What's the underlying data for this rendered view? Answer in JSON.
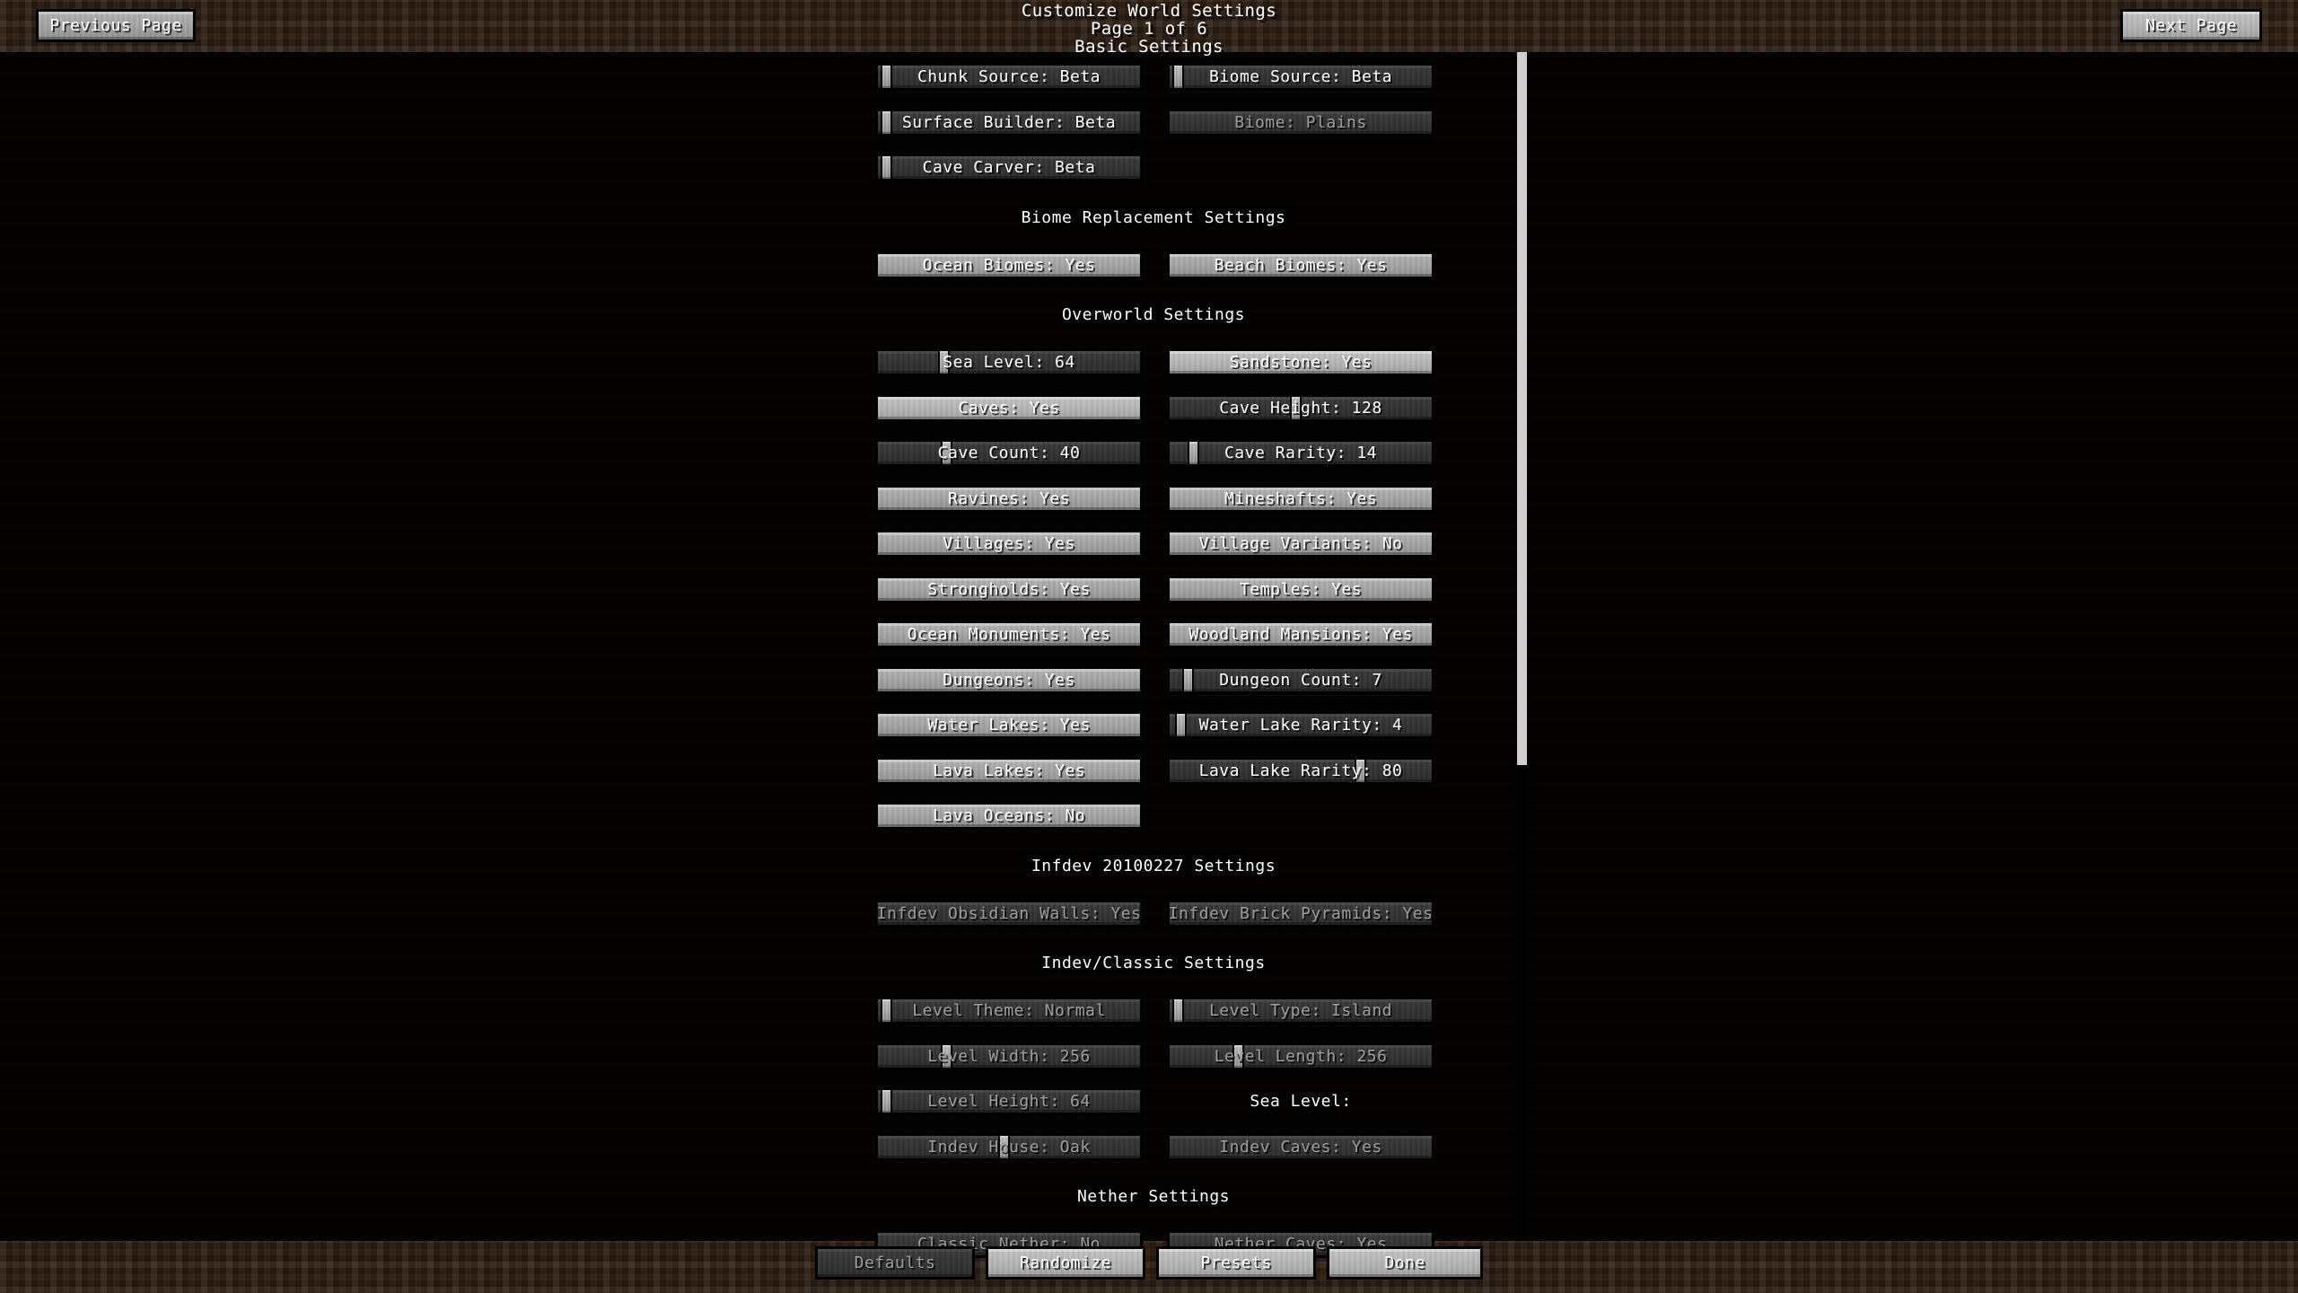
{
  "window": {
    "title": "Customize World Settings",
    "page_indicator": "Page 1 of 6",
    "subtitle": "Basic Settings"
  },
  "nav": {
    "previous_page": "Previous Page",
    "next_page": "Next Page"
  },
  "footer": {
    "defaults": "Defaults",
    "randomize": "Randomize",
    "presets": "Presets",
    "done": "Done"
  },
  "scrollbar": {
    "thumb_top_pct": 0,
    "thumb_height_pct": 60
  },
  "sections": [
    {
      "heading": "",
      "rows": [
        {
          "left": {
            "label": "Chunk Source: Beta",
            "state": "slider",
            "knob_pct": 1
          },
          "right": {
            "label": "Biome Source: Beta",
            "state": "slider",
            "knob_pct": 1
          }
        },
        {
          "left": {
            "label": "Surface Builder: Beta",
            "state": "slider",
            "knob_pct": 1
          },
          "right": {
            "label": "Biome: Plains",
            "state": "disabled"
          }
        },
        {
          "left": {
            "label": "Cave Carver: Beta",
            "state": "slider",
            "knob_pct": 1
          },
          "right": null
        }
      ]
    },
    {
      "heading": "Biome Replacement Settings",
      "rows": [
        {
          "left": {
            "label": "Ocean Biomes: Yes",
            "state": "normal"
          },
          "right": {
            "label": "Beach Biomes: Yes",
            "state": "normal"
          }
        }
      ]
    },
    {
      "heading": "Overworld Settings",
      "rows": [
        {
          "left": {
            "label": "Sea Level: 64",
            "state": "slider",
            "knob_pct": 24
          },
          "right": {
            "label": "Sandstone: Yes",
            "state": "hover"
          }
        },
        {
          "left": {
            "label": "Caves: Yes",
            "state": "hover"
          },
          "right": {
            "label": "Cave Height: 128",
            "state": "slider",
            "knob_pct": 48
          }
        },
        {
          "left": {
            "label": "Cave Count: 40",
            "state": "slider",
            "knob_pct": 25
          },
          "right": {
            "label": "Cave Rarity: 14",
            "state": "slider",
            "knob_pct": 7
          }
        },
        {
          "left": {
            "label": "Ravines: Yes",
            "state": "normal"
          },
          "right": {
            "label": "Mineshafts: Yes",
            "state": "normal"
          }
        },
        {
          "left": {
            "label": "Villages: Yes",
            "state": "normal"
          },
          "right": {
            "label": "Village Variants: No",
            "state": "normal"
          }
        },
        {
          "left": {
            "label": "Strongholds: Yes",
            "state": "normal"
          },
          "right": {
            "label": "Temples: Yes",
            "state": "normal"
          }
        },
        {
          "left": {
            "label": "Ocean Monuments: Yes",
            "state": "normal"
          },
          "right": {
            "label": "Woodland Mansions: Yes",
            "state": "normal"
          }
        },
        {
          "left": {
            "label": "Dungeons: Yes",
            "state": "normal"
          },
          "right": {
            "label": "Dungeon Count: 7",
            "state": "slider",
            "knob_pct": 5
          }
        },
        {
          "left": {
            "label": "Water Lakes: Yes",
            "state": "normal"
          },
          "right": {
            "label": "Water Lake Rarity: 4",
            "state": "slider",
            "knob_pct": 2
          }
        },
        {
          "left": {
            "label": "Lava Lakes: Yes",
            "state": "normal"
          },
          "right": {
            "label": "Lava Lake Rarity: 80",
            "state": "slider",
            "knob_pct": 74
          }
        },
        {
          "left": {
            "label": "Lava Oceans: No",
            "state": "normal"
          },
          "right": null
        }
      ]
    },
    {
      "heading": "Infdev 20100227 Settings",
      "rows": [
        {
          "left": {
            "label": "Infdev Obsidian Walls: Yes",
            "state": "disabled"
          },
          "right": {
            "label": "Infdev Brick Pyramids: Yes",
            "state": "disabled"
          }
        }
      ]
    },
    {
      "heading": "Indev/Classic Settings",
      "rows": [
        {
          "left": {
            "label": "Level Theme: Normal",
            "state": "slider",
            "knob_pct": 1,
            "dim": true
          },
          "right": {
            "label": "Level Type: Island",
            "state": "slider",
            "knob_pct": 1,
            "dim": true
          }
        },
        {
          "left": {
            "label": "Level Width: 256",
            "state": "slider",
            "knob_pct": 25,
            "dim": true
          },
          "right": {
            "label": "Level Length: 256",
            "state": "slider",
            "knob_pct": 25,
            "dim": true
          }
        },
        {
          "left": {
            "label": "Level Height: 64",
            "state": "slider",
            "knob_pct": 1,
            "dim": true
          },
          "right": {
            "label": "Sea Level:",
            "state": "bare"
          }
        },
        {
          "left": {
            "label": "Indev House: Oak",
            "state": "slider",
            "knob_pct": 48,
            "dim": true
          },
          "right": {
            "label": "Indev Caves: Yes",
            "state": "disabled"
          }
        }
      ]
    },
    {
      "heading": "Nether Settings",
      "rows": [
        {
          "left": {
            "label": "Classic Nether: No",
            "state": "disabled"
          },
          "right": {
            "label": "Nether Caves: Yes",
            "state": "disabled"
          }
        }
      ]
    }
  ]
}
